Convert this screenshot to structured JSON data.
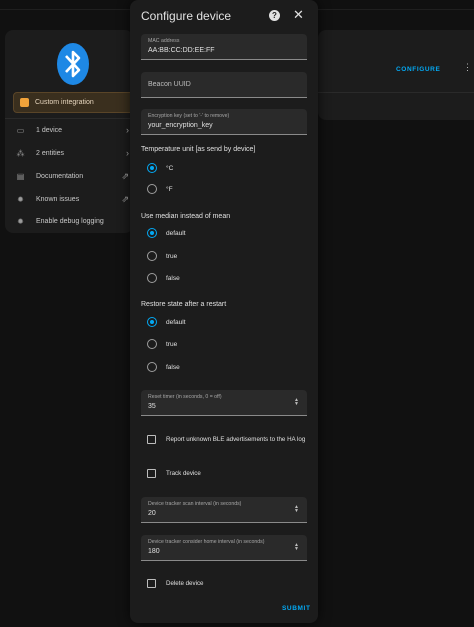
{
  "background": {
    "integration_card": {
      "badge_label": "Custom integration",
      "items": [
        {
          "icon": "device-icon",
          "label": "1 device",
          "chevron": "›"
        },
        {
          "icon": "entities-icon",
          "label": "2 entities",
          "chevron": "›"
        },
        {
          "icon": "book-icon",
          "label": "Documentation",
          "trail": "⇗"
        },
        {
          "icon": "bug-icon",
          "label": "Known issues",
          "trail": "⇗"
        },
        {
          "icon": "bug-icon",
          "label": "Enable debug logging"
        }
      ]
    },
    "configure_label": "CONFIGURE"
  },
  "dialog": {
    "title": "Configure device",
    "fields": {
      "mac": {
        "label": "MAC address",
        "value": "AA:BB:CC:DD:EE:FF"
      },
      "beacon": {
        "placeholder": "Beacon UUID"
      },
      "encryption": {
        "label": "Encryption key (set to '-' to remove)",
        "value": "your_encryption_key"
      },
      "reset_timer": {
        "label": "Reset timer (in seconds, 0 = off)",
        "value": "35"
      },
      "scan_interval": {
        "label": "Device tracker scan interval (in seconds)",
        "value": "20"
      },
      "consider_home": {
        "label": "Device tracker consider home interval (in seconds)",
        "value": "180"
      }
    },
    "temperature": {
      "title": "Temperature unit [as send by device]",
      "options": [
        "°C",
        "°F"
      ],
      "selected": "°C"
    },
    "median": {
      "title": "Use median instead of mean",
      "options": [
        "default",
        "true",
        "false"
      ],
      "selected": "default"
    },
    "restore": {
      "title": "Restore state after a restart",
      "options": [
        "default",
        "true",
        "false"
      ],
      "selected": "default"
    },
    "checkboxes": {
      "report_unknown": {
        "label": "Report unknown BLE advertisements to the HA log",
        "checked": false
      },
      "track_device": {
        "label": "Track device",
        "checked": false
      },
      "delete_device": {
        "label": "Delete device",
        "checked": false
      }
    },
    "submit_label": "SUBMIT"
  },
  "colors": {
    "accent": "#03a9f4",
    "bluetooth": "#1e88e5",
    "custom_badge": "#f2a33a"
  }
}
